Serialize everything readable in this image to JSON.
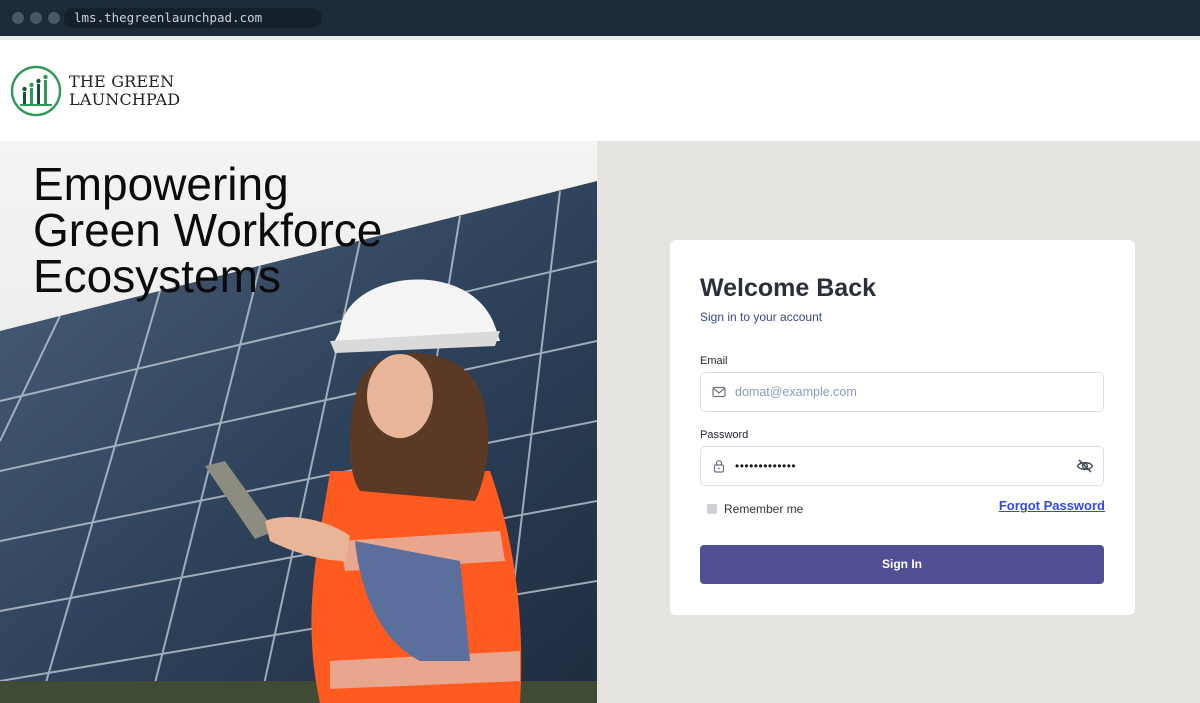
{
  "browser": {
    "url": "lms.thegreenlaunchpad.com"
  },
  "brand": {
    "line1": "THE GREEN",
    "line2": "LAUNCHPAD",
    "color": "#2e9a57"
  },
  "hero": {
    "title_line1": "Empowering",
    "title_line2": "Green Workforce",
    "title_line3": "Ecosystems"
  },
  "login": {
    "title": "Welcome Back",
    "subtitle": "Sign in to your account",
    "email_label": "Email",
    "email_placeholder": "domat@example.com",
    "password_label": "Password",
    "password_value": "•••••••••••••",
    "remember_label": "Remember me",
    "forgot_label": "Forgot Password",
    "signin_label": "Sign In",
    "accent_color": "#514f93",
    "link_color": "#3549d8"
  },
  "icons": {
    "email": "mail-icon",
    "password": "lock-icon",
    "visibility": "eye-off-icon"
  }
}
